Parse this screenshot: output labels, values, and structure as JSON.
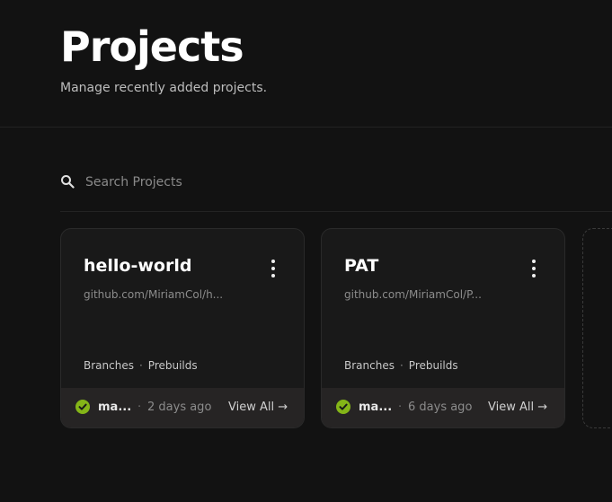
{
  "header": {
    "title": "Projects",
    "subtitle": "Manage recently added projects."
  },
  "search": {
    "placeholder": "Search Projects",
    "value": ""
  },
  "projects": [
    {
      "name": "hello-world",
      "repo": "github.com/MiriamCol/h...",
      "branches_label": "Branches",
      "separator": "·",
      "prebuilds_label": "Prebuilds",
      "branch": "ma...",
      "time": "2 days ago",
      "view_all": "View All →",
      "status": "success"
    },
    {
      "name": "PAT",
      "repo": "github.com/MiriamCol/P...",
      "branches_label": "Branches",
      "separator": "·",
      "prebuilds_label": "Prebuilds",
      "branch": "ma...",
      "time": "6 days ago",
      "view_all": "View All →",
      "status": "success"
    }
  ],
  "icons": {
    "search": "search-icon",
    "menu": "more-vertical-icon",
    "status": "check-circle-icon"
  },
  "colors": {
    "background": "#121212",
    "card": "#191919",
    "card_footer": "#262424",
    "success": "#84b518"
  }
}
